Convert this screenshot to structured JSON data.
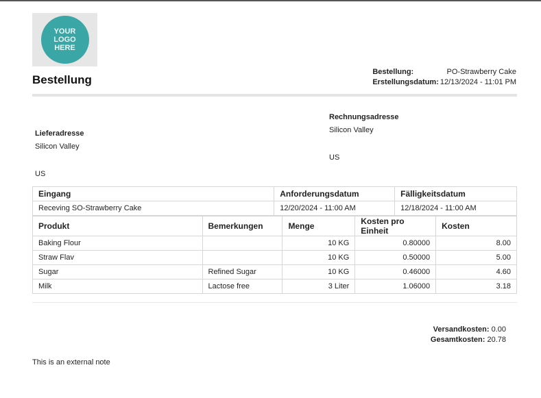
{
  "logo": {
    "text": "YOUR\nLOGO\nHERE"
  },
  "title": "Bestellung",
  "meta": {
    "order_label": "Bestellung:",
    "order_value": "PO-Strawberry Cake",
    "created_label": "Erstellungsdatum:",
    "created_value": "12/13/2024 - 11:01 PM"
  },
  "shipping": {
    "heading": "Lieferadresse",
    "line1": "Silicon Valley",
    "line2": "",
    "country": "US"
  },
  "billing": {
    "heading": "Rechnungsadresse",
    "line1": "Silicon Valley",
    "line2": "",
    "country": "US"
  },
  "receipt": {
    "headers": [
      "Eingang",
      "Anforderungsdatum",
      "Fälligkeitsdatum"
    ],
    "row": [
      "Receving SO-Strawberry Cake",
      "12/20/2024 - 11:00 AM",
      "12/18/2024 - 11:00 AM"
    ]
  },
  "products": {
    "headers": [
      "Produkt",
      "Bemerkungen",
      "Menge",
      "Kosten pro Einheit",
      "Kosten"
    ],
    "rows": [
      [
        "Baking Flour",
        "",
        "10 KG",
        "0.80000",
        "8.00"
      ],
      [
        "Straw Flav",
        "",
        "10 KG",
        "0.50000",
        "5.00"
      ],
      [
        "Sugar",
        "Refined Sugar",
        "10 KG",
        "0.46000",
        "4.60"
      ],
      [
        "Milk",
        "Lactose free",
        "3 Liter",
        "1.06000",
        "3.18"
      ]
    ]
  },
  "totals": {
    "shipping_label": "Versandkosten:",
    "shipping_value": "0.00",
    "total_label": "Gesamtkosten:",
    "total_value": "20.78"
  },
  "note": "This is an external note"
}
